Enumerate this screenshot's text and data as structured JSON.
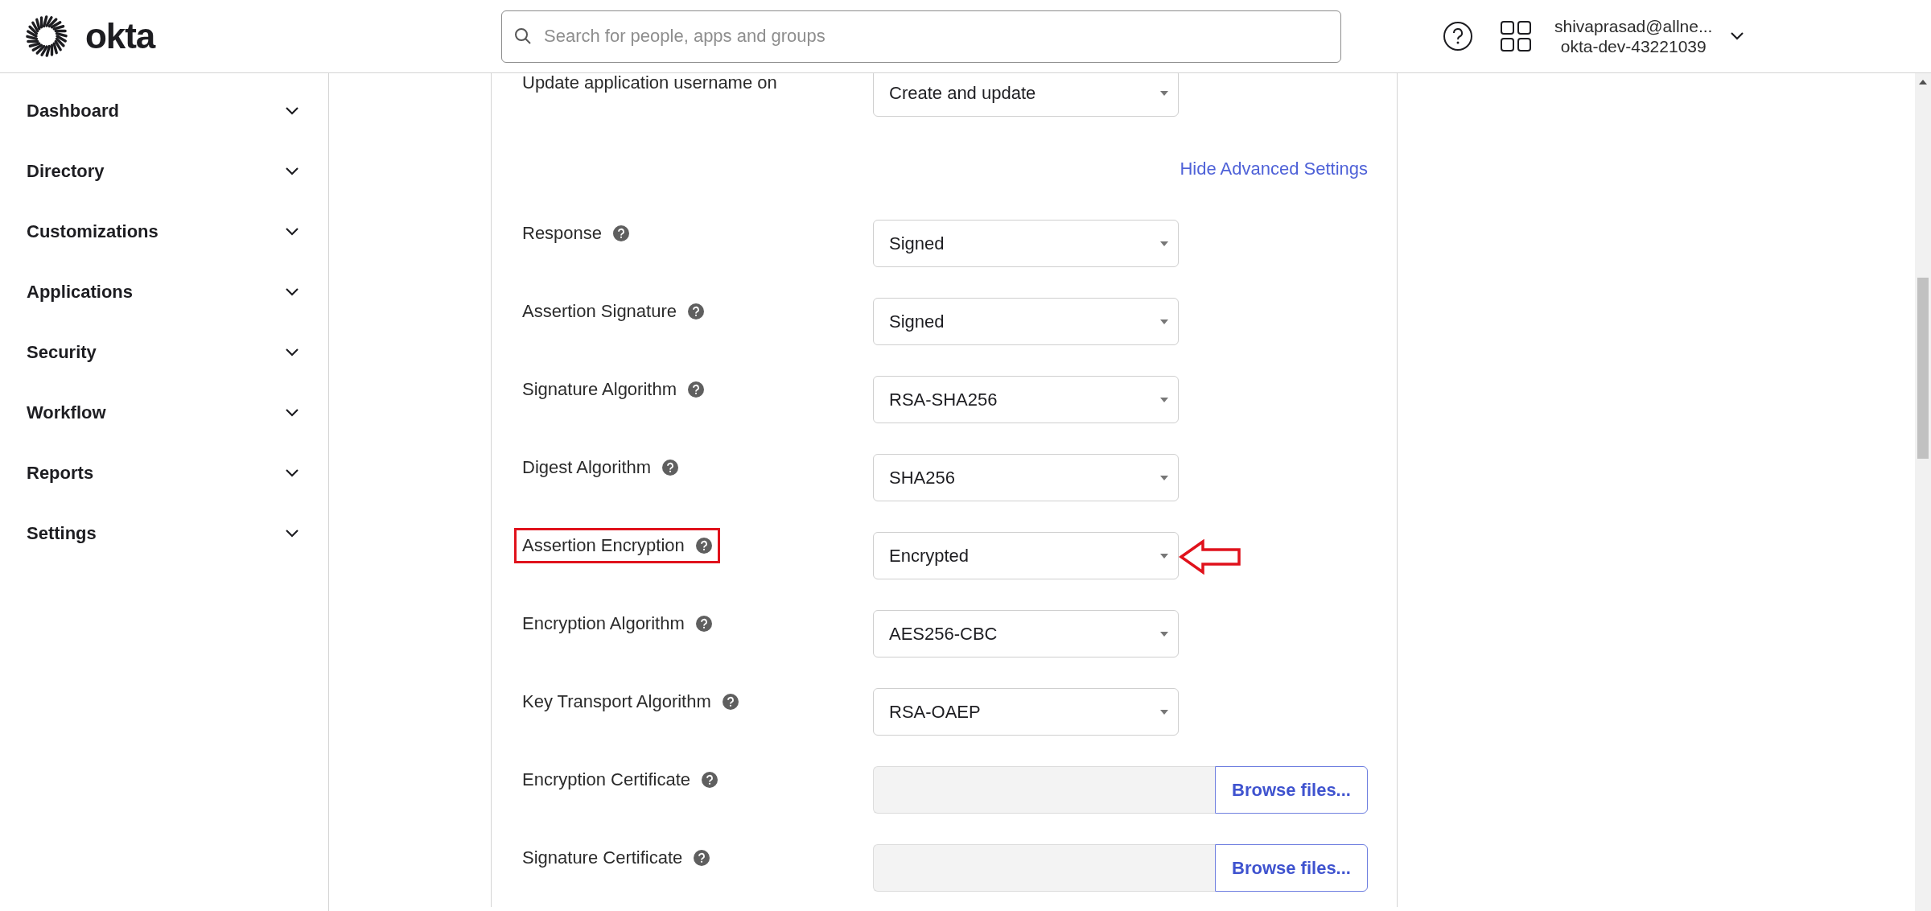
{
  "header": {
    "brand": "okta",
    "search": {
      "placeholder": "Search for people, apps and groups"
    },
    "user": {
      "email": "shivaprasad@allne...",
      "org": "okta-dev-43221039"
    }
  },
  "sidebar": {
    "items": [
      {
        "label": "Dashboard",
        "expanded": false
      },
      {
        "label": "Directory",
        "expanded": false
      },
      {
        "label": "Customizations",
        "expanded": false
      },
      {
        "label": "Applications",
        "expanded": false
      },
      {
        "label": "Security",
        "expanded": false
      },
      {
        "label": "Workflow",
        "expanded": false
      },
      {
        "label": "Reports",
        "expanded": false
      },
      {
        "label": "Settings",
        "expanded": false
      }
    ]
  },
  "form": {
    "fields": [
      {
        "kind": "select",
        "label": "Update application username on",
        "help": false,
        "value": "Create and update",
        "annotated": false
      },
      {
        "kind": "link",
        "label": "Hide Advanced Settings",
        "annotated": false
      },
      {
        "kind": "select",
        "label": "Response",
        "help": true,
        "value": "Signed",
        "annotated": false
      },
      {
        "kind": "select",
        "label": "Assertion Signature",
        "help": true,
        "value": "Signed",
        "annotated": false
      },
      {
        "kind": "select",
        "label": "Signature Algorithm",
        "help": true,
        "value": "RSA-SHA256",
        "annotated": false
      },
      {
        "kind": "select",
        "label": "Digest Algorithm",
        "help": true,
        "value": "SHA256",
        "annotated": false
      },
      {
        "kind": "select",
        "label": "Assertion Encryption",
        "help": true,
        "value": "Encrypted",
        "annotated": true
      },
      {
        "kind": "select",
        "label": "Encryption Algorithm",
        "help": true,
        "value": "AES256-CBC",
        "annotated": false
      },
      {
        "kind": "select",
        "label": "Key Transport Algorithm",
        "help": true,
        "value": "RSA-OAEP",
        "annotated": false
      },
      {
        "kind": "file",
        "label": "Encryption Certificate",
        "help": true,
        "button": "Browse files...",
        "annotated": false
      },
      {
        "kind": "file",
        "label": "Signature Certificate",
        "help": true,
        "button": "Browse files...",
        "annotated": false
      }
    ]
  }
}
